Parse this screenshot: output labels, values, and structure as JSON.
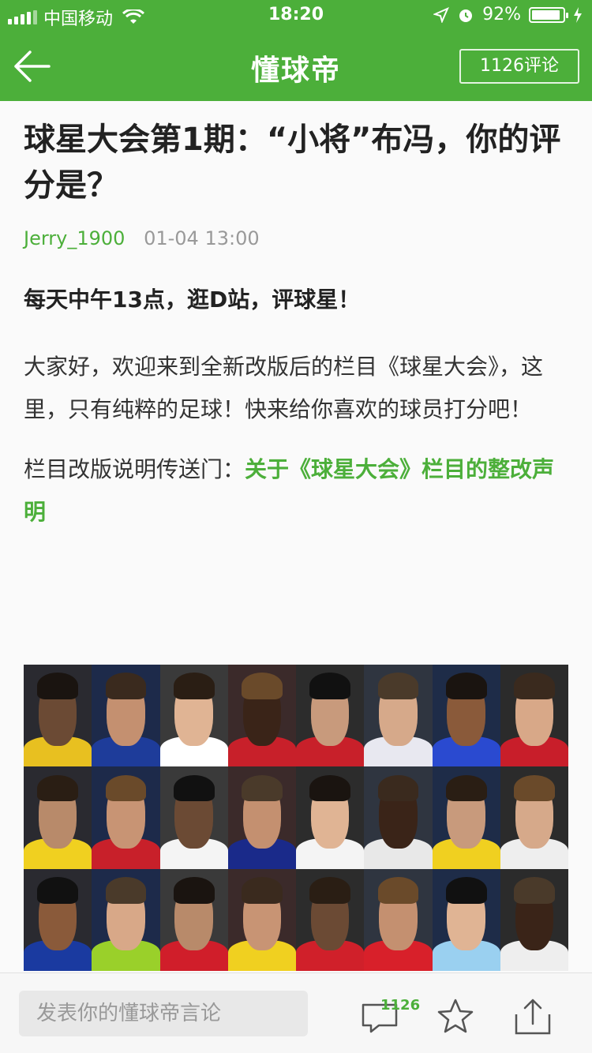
{
  "status_bar": {
    "carrier": "中国移动",
    "time": "18:20",
    "battery": "92%",
    "battery_level": 0.92
  },
  "nav": {
    "title": "懂球帝",
    "comment_button": "1126评论"
  },
  "article": {
    "title": "球星大会第1期：“小将”布冯，你的评分是？",
    "author": "Jerry_1900",
    "date": "01-04 13:00",
    "lead": "每天中午13点，逛D站，评球星！",
    "paragraph": "大家好，欢迎来到全新改版后的栏目《球星大会》，这里，只有纯粹的足球！快来给你喜欢的球员打分吧！",
    "link_prefix": "栏目改版说明传送门：",
    "link_text": "关于《球星大会》栏目的整改声明"
  },
  "bottom_bar": {
    "input_placeholder": "发表你的懂球帝言论",
    "comment_count": "1126"
  },
  "colors": {
    "brand_green": "#4caf3a",
    "text_dark": "#222222",
    "meta_grey": "#999999"
  },
  "icons": [
    "back-arrow-icon",
    "comment-icon",
    "star-icon",
    "share-icon",
    "wifi-icon",
    "location-icon",
    "alarm-icon",
    "battery-icon"
  ]
}
